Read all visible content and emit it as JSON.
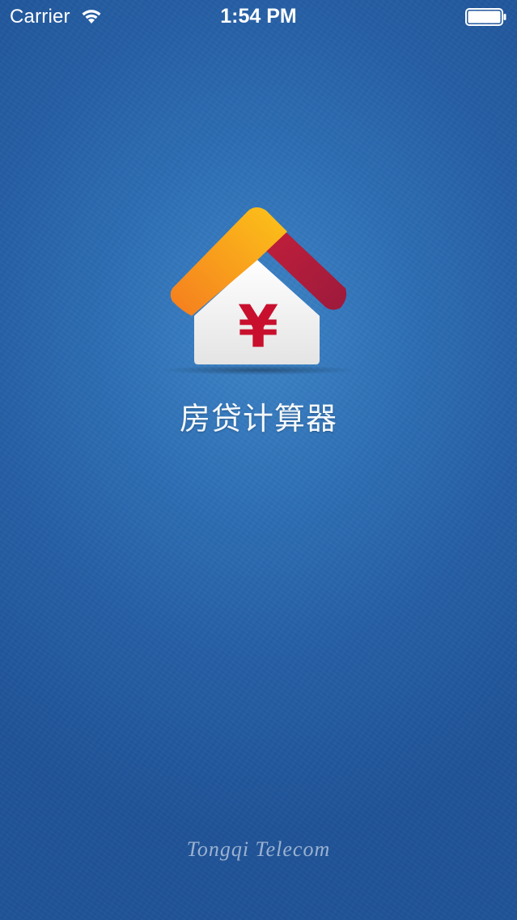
{
  "status_bar": {
    "carrier": "Carrier",
    "time": "1:54 PM",
    "wifi_icon": "wifi-icon",
    "battery_icon": "battery-icon"
  },
  "splash": {
    "logo_icon": "house-yuan-icon",
    "logo_symbol": "¥",
    "app_title": "房贷计算器",
    "company": "Tongqi Telecom"
  },
  "colors": {
    "background": "#2e6fb5",
    "roof_left": "#f5a623",
    "roof_right": "#b3203a",
    "house_body": "#f2f2f2",
    "yuan_symbol": "#c8102e"
  }
}
